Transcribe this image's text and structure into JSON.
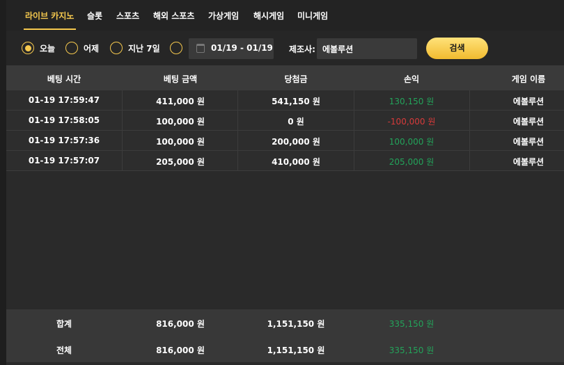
{
  "tabs": [
    {
      "label": "라이브 카지노",
      "active": true
    },
    {
      "label": "슬롯",
      "active": false
    },
    {
      "label": "스포츠",
      "active": false
    },
    {
      "label": "해외 스포츠",
      "active": false
    },
    {
      "label": "가상게임",
      "active": false
    },
    {
      "label": "해시게임",
      "active": false
    },
    {
      "label": "미니게임",
      "active": false
    }
  ],
  "filter": {
    "radios": [
      {
        "label": "오늘",
        "selected": true
      },
      {
        "label": "어제",
        "selected": false
      },
      {
        "label": "지난 7일",
        "selected": false
      },
      {
        "label": "",
        "selected": false
      }
    ],
    "date_range": "01/19 - 01/19",
    "maker_label": "제조사:",
    "maker_value": "에볼루션",
    "search_label": "검색"
  },
  "table": {
    "headers": [
      "베팅 시간",
      "베팅 금액",
      "당첨금",
      "손익",
      "게임 이름"
    ],
    "rows": [
      {
        "time": "01-19 17:59:47",
        "bet": "411,000 원",
        "win": "541,150 원",
        "pl": "130,150 원",
        "pl_sign": "pos",
        "game": "에볼루션"
      },
      {
        "time": "01-19 17:58:05",
        "bet": "100,000 원",
        "win": "0 원",
        "pl": "-100,000 원",
        "pl_sign": "neg",
        "game": "에볼루션"
      },
      {
        "time": "01-19 17:57:36",
        "bet": "100,000 원",
        "win": "200,000 원",
        "pl": "100,000 원",
        "pl_sign": "pos",
        "game": "에볼루션"
      },
      {
        "time": "01-19 17:57:07",
        "bet": "205,000 원",
        "win": "410,000 원",
        "pl": "205,000 원",
        "pl_sign": "pos",
        "game": "에볼루션"
      }
    ],
    "totals": [
      {
        "label": "합계",
        "bet": "816,000 원",
        "win": "1,151,150 원",
        "pl": "335,150 원"
      },
      {
        "label": "전체",
        "bet": "816,000 원",
        "win": "1,151,150 원",
        "pl": "335,150 원"
      }
    ]
  },
  "colors": {
    "accent": "#f6c94e",
    "positive": "#23a35a",
    "negative": "#d83a3a"
  }
}
